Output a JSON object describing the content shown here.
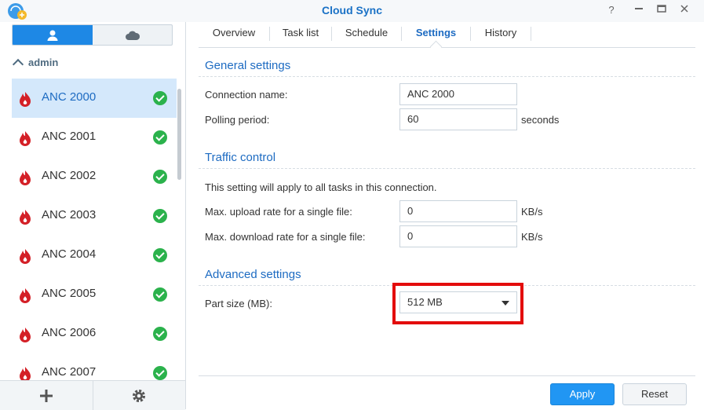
{
  "window": {
    "title": "Cloud Sync",
    "controls": [
      "help-icon",
      "minimize-icon",
      "maximize-icon",
      "close-icon"
    ]
  },
  "sidebar": {
    "group": "admin",
    "connections": [
      {
        "name": "ANC 2000",
        "status": "ok",
        "selected": true
      },
      {
        "name": "ANC 2001",
        "status": "ok"
      },
      {
        "name": "ANC 2002",
        "status": "ok"
      },
      {
        "name": "ANC 2003",
        "status": "ok"
      },
      {
        "name": "ANC 2004",
        "status": "ok"
      },
      {
        "name": "ANC 2005",
        "status": "ok"
      },
      {
        "name": "ANC 2006",
        "status": "ok"
      },
      {
        "name": "ANC 2007",
        "status": "ok"
      }
    ]
  },
  "tabs": [
    {
      "label": "Overview"
    },
    {
      "label": "Task list"
    },
    {
      "label": "Schedule"
    },
    {
      "label": "Settings",
      "active": true
    },
    {
      "label": "History"
    }
  ],
  "general": {
    "title": "General settings",
    "connection_name_label": "Connection name:",
    "connection_name_value": "ANC 2000",
    "polling_label": "Polling period:",
    "polling_value": "60",
    "polling_unit": "seconds"
  },
  "traffic": {
    "title": "Traffic control",
    "note": "This setting will apply to all tasks in this connection.",
    "upload_label": "Max. upload rate for a single file:",
    "upload_value": "0",
    "upload_unit": "KB/s",
    "download_label": "Max. download rate for a single file:",
    "download_value": "0",
    "download_unit": "KB/s"
  },
  "advanced": {
    "title": "Advanced settings",
    "part_size_label": "Part size (MB):",
    "part_size_value": "512 MB"
  },
  "footer": {
    "apply": "Apply",
    "reset": "Reset"
  },
  "colors": {
    "accent": "#1d6bc2",
    "highlight": "#e30c0c",
    "status_ok": "#2bb24c",
    "brand": "#d42027"
  }
}
